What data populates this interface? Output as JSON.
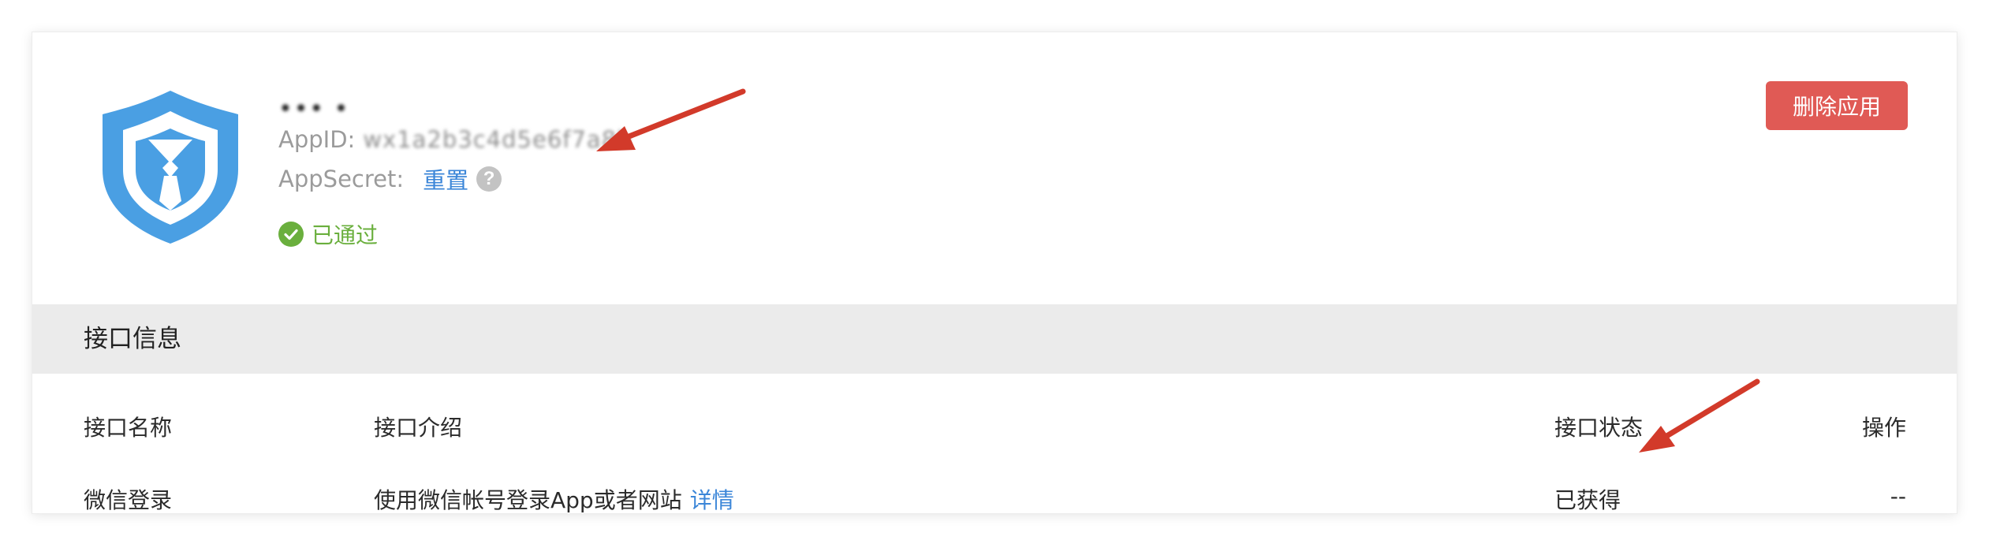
{
  "app": {
    "name": "••• •",
    "appid_label": "AppID:",
    "appid_value": "wx1a2b3c4d5e6f7a8b",
    "appsecret_label": "AppSecret:",
    "reset_label": "重置",
    "help_symbol": "?",
    "status_label": "已通过",
    "delete_label": "删除应用"
  },
  "section": {
    "title": "接口信息"
  },
  "table": {
    "headers": {
      "name": "接口名称",
      "description": "接口介绍",
      "status": "接口状态",
      "action": "操作"
    },
    "rows": [
      {
        "name": "微信登录",
        "description": "使用微信帐号登录App或者网站",
        "detail_link": "详情",
        "status": "已获得",
        "action": "--"
      }
    ]
  },
  "colors": {
    "logo_blue": "#4a9fe3",
    "status_green": "#6aaf3d",
    "delete_red": "#e05a55",
    "link_blue": "#3b86d8",
    "arrow_red": "#d23a2a"
  },
  "icons": {
    "logo": "shield-tie-logo",
    "help": "question-circle-icon",
    "status": "check-circle-icon",
    "annotation": "arrow-annotation"
  }
}
